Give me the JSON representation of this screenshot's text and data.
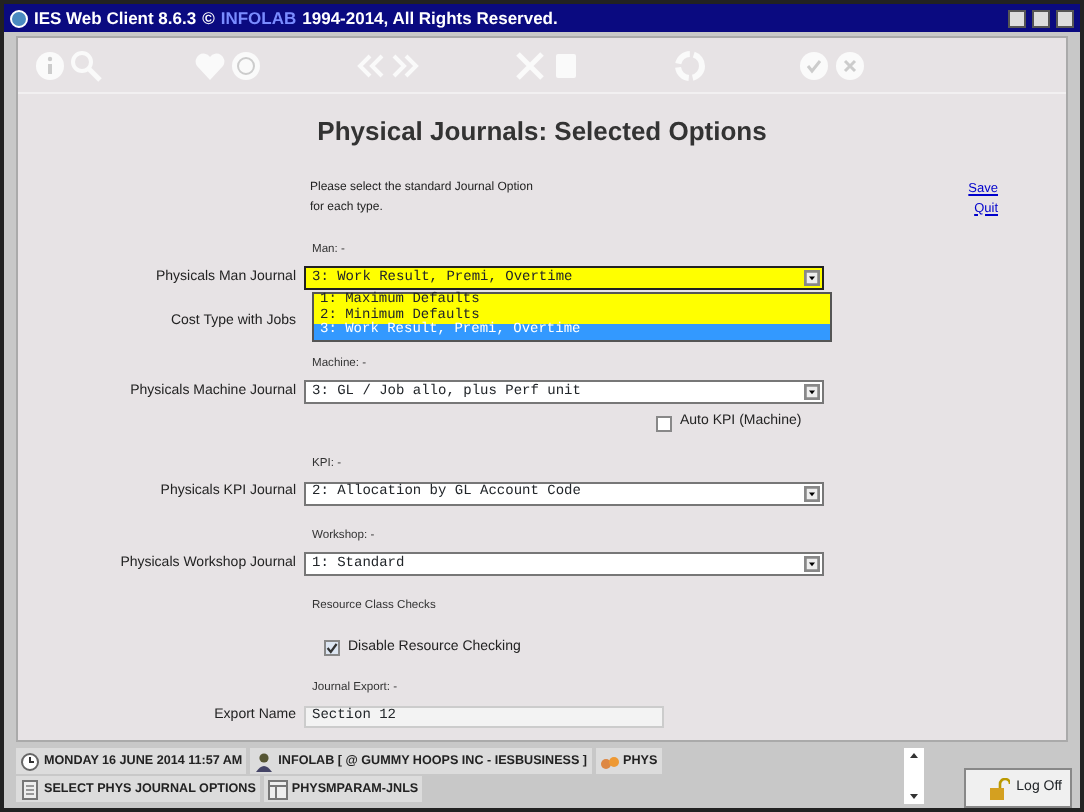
{
  "window": {
    "title": "IES Web Client 8.6.3",
    "copyright_sign": "©",
    "brand": "INFOLAB",
    "rights": "1994-2014, All Rights Reserved."
  },
  "heading": "Physical Journals: Selected Options",
  "intro": [
    "Please select the standard Journal Option",
    "for each type."
  ],
  "links": [
    "Save",
    "Quit"
  ],
  "form": [
    {
      "kind": "note",
      "text": "Man: -"
    },
    {
      "kind": "select",
      "label": "Physicals Man Journal",
      "value": "3: Work Result, Premi, Overtime",
      "highlighted": true,
      "expanded": true,
      "options": [
        {
          "text": "1: Maximum Defaults",
          "selected": false
        },
        {
          "text": "2: Minimum Defaults",
          "selected": false
        },
        {
          "text": "3: Work Result, Premi, Overtime",
          "selected": true
        }
      ]
    },
    {
      "kind": "label",
      "label": "Cost Type with Jobs"
    },
    {
      "kind": "note",
      "text": "Machine: -"
    },
    {
      "kind": "select",
      "label": "Physicals Machine Journal",
      "value": "3: GL / Job allo, plus Perf unit",
      "highlighted": false,
      "expanded": false
    },
    {
      "kind": "side_checkbox",
      "label": "Auto KPI (Machine)",
      "checked": false
    },
    {
      "kind": "note",
      "text": "KPI: -"
    },
    {
      "kind": "select",
      "label": "Physicals KPI Journal",
      "value": "2: Allocation by GL Account Code",
      "highlighted": false,
      "expanded": false
    },
    {
      "kind": "note",
      "text": "Workshop: -"
    },
    {
      "kind": "select",
      "label": "Physicals Workshop Journal",
      "value": "1: Standard",
      "highlighted": false,
      "expanded": false
    },
    {
      "kind": "note",
      "text": "Resource Class Checks"
    },
    {
      "kind": "checkbox",
      "label": "Disable Resource Checking",
      "checked": true
    },
    {
      "kind": "note",
      "text": "Journal Export: -"
    },
    {
      "kind": "text",
      "label": "Export Name",
      "value": "Section 12"
    }
  ],
  "status_bar": [
    {
      "kind": "clock",
      "text": "MONDAY 16 JUNE 2014 11:57 AM"
    },
    {
      "kind": "user",
      "text": "INFOLAB [ @ GUMMY HOOPS INC - IESBUSINESS ]"
    },
    {
      "kind": "module",
      "text": "PHYS"
    },
    {
      "kind": "document",
      "text": "SELECT PHYS JOURNAL OPTIONS"
    },
    {
      "kind": "screen",
      "text": "PHYSMPARAM-JNLS"
    }
  ],
  "logoff": "Log Off"
}
